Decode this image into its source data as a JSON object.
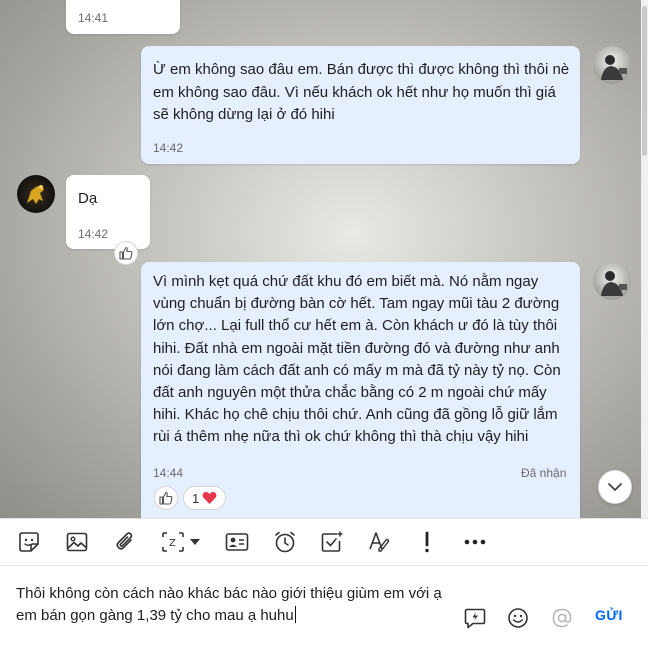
{
  "messages": [
    {
      "direction": "in",
      "text": "",
      "time": "14:41"
    },
    {
      "direction": "out",
      "lines": [
        "Ừ em không sao đâu em. Bán được thì được không thì thôi nè",
        "em không sao đâu. Vì nếu khách ok hết như họ muốn thì giá",
        "sẽ không dừng lại ở đó hihi"
      ],
      "time": "14:42"
    },
    {
      "direction": "in",
      "text": "Dạ",
      "time": "14:42"
    },
    {
      "direction": "out",
      "lines": [
        "Vì mình kẹt quá chứ đất khu đó em biết mà. Nó nằm ngay",
        "vùng chuẩn bị đường bàn cờ hết. Tam ngay mũi tàu 2 đường",
        "lớn chợ... Lại full thổ cư hết em à. Còn khách ư đó là tùy thôi",
        "hihi. Đất nhà em ngoài mặt tiền đường đó và đường như anh",
        "nói đang làm cách đất anh có mấy m mà đã tỷ này tỷ nọ. Còn",
        "đất anh nguyên một thửa chắc bằng có 2 m ngoài chứ mấy",
        "hihi. Khác họ chê chịu thôi chứ. Anh cũng đã gồng lỗ giữ lắm",
        "rùi á thêm nhẹ nữa thì ok chứ không thì thà chịu vậy hihi"
      ],
      "time": "14:44",
      "status": "Đã nhận",
      "reaction_count": "1"
    }
  ],
  "composer": {
    "lines": [
      "Thôi không còn cách nào khác bác nào giới thiệu giùm em với ạ",
      "em bán gọn gàng 1,39 tỷ cho mau ạ huhu"
    ],
    "send_label": "GỬI"
  },
  "toolbar": {
    "icons": [
      "sticker-icon",
      "image-icon",
      "attachment-icon",
      "screenshot-icon",
      "contact-card-icon",
      "reminder-icon",
      "todo-icon",
      "text-format-icon",
      "urgent-icon",
      "more-icon"
    ]
  },
  "colors": {
    "accent": "#0068ff",
    "out_bubble": "#e5efff",
    "in_bubble": "#ffffff",
    "heart": "#e8364a"
  }
}
